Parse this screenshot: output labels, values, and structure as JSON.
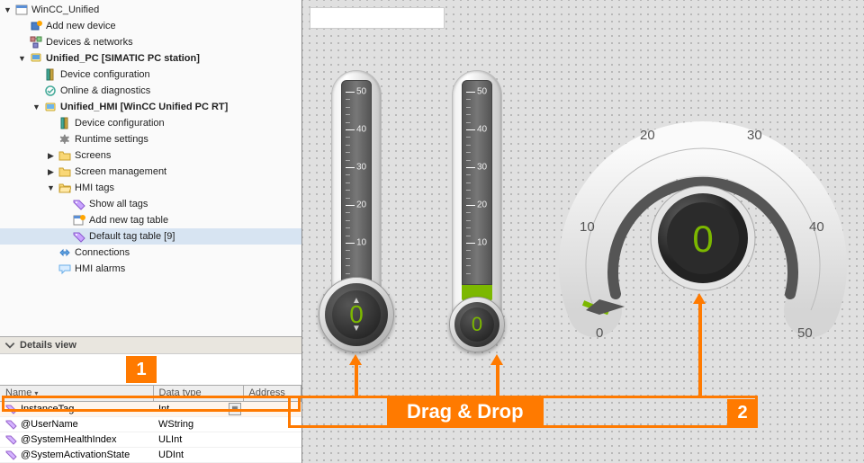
{
  "tree": {
    "root": "WinCC_Unified",
    "add_device": "Add new device",
    "devices_networks": "Devices & networks",
    "pc_station": "Unified_PC [SIMATIC PC station]",
    "dev_config1": "Device configuration",
    "online_diag": "Online & diagnostics",
    "hmi_rt": "Unified_HMI [WinCC Unified PC RT]",
    "dev_config2": "Device configuration",
    "runtime_settings": "Runtime settings",
    "screens": "Screens",
    "screen_mgmt": "Screen management",
    "hmi_tags": "HMI tags",
    "show_all_tags": "Show all tags",
    "add_tag_table": "Add new tag table",
    "default_tag_table": "Default tag table [9]",
    "connections": "Connections",
    "hmi_alarms": "HMI alarms"
  },
  "details": {
    "title": "Details view",
    "col_name": "Name",
    "col_type": "Data type",
    "col_addr": "Address",
    "rows": [
      {
        "name": "InstanceTag",
        "type": "Int"
      },
      {
        "name": "@UserName",
        "type": "WString"
      },
      {
        "name": "@SystemHealthIndex",
        "type": "ULInt"
      },
      {
        "name": "@SystemActivationState",
        "type": "UDInt"
      }
    ]
  },
  "gauges": {
    "bar_ticks": [
      "50",
      "40",
      "30",
      "20",
      "10"
    ],
    "bar1_value": "0",
    "bar2_value": "0",
    "radial_value": "0",
    "radial_ticks": [
      "0",
      "10",
      "20",
      "30",
      "40",
      "50"
    ]
  },
  "callouts": {
    "one": "1",
    "two": "2",
    "drag_drop": "Drag & Drop"
  }
}
